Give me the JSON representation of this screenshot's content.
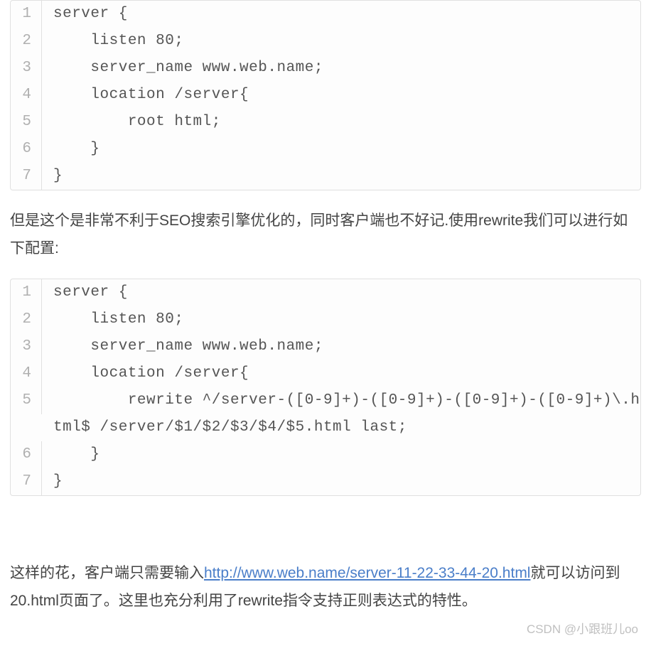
{
  "code_block_1": {
    "lines": [
      {
        "num": "1",
        "code": "server {"
      },
      {
        "num": "2",
        "code": "    listen 80;"
      },
      {
        "num": "3",
        "code": "    server_name www.web.name;"
      },
      {
        "num": "4",
        "code": "    location /server{"
      },
      {
        "num": "5",
        "code": "        root html;"
      },
      {
        "num": "6",
        "code": "    }"
      },
      {
        "num": "7",
        "code": "}"
      }
    ]
  },
  "paragraph_1": "但是这个是非常不利于SEO搜索引擎优化的，同时客户端也不好记.使用rewrite我们可以进行如下配置:",
  "code_block_2": {
    "lines": [
      {
        "num": "1",
        "code": "server {"
      },
      {
        "num": "2",
        "code": "    listen 80;"
      },
      {
        "num": "3",
        "code": "    server_name www.web.name;"
      },
      {
        "num": "4",
        "code": "    location /server{"
      },
      {
        "num": "5",
        "code": "        rewrite ^/server-([0-9]+)-([0-9]+)-([0-9]+)-([0-9]+)\\.html$ /server/$1/$2/$3/$4/$5.html last;"
      },
      {
        "num": "6",
        "code": "    }"
      },
      {
        "num": "7",
        "code": "}"
      }
    ]
  },
  "paragraph_2": {
    "before": "这样的花，客户端只需要输入",
    "link_text": "http://www.web.name/server-11-22-33-44-20.html",
    "after": "就可以访问到20.html页面了。这里也充分利用了rewrite指令支持正则表达式的特性。"
  },
  "watermark": "CSDN @小跟班儿oo"
}
